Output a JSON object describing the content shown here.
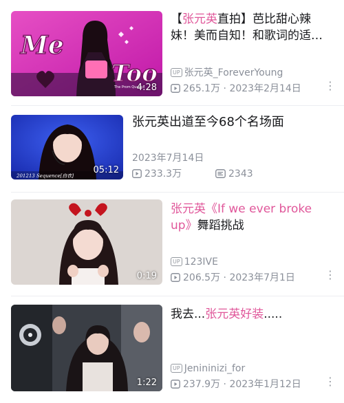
{
  "videos": [
    {
      "title_prefix": "【",
      "title_highlight": "张元英",
      "title_rest": "直拍】芭比甜心辣妹！美而自知！和歌词的适…",
      "thumb_overlay_text_1": "Me",
      "thumb_overlay_text_2": "Too",
      "thumb_overlay_small": "The Prom Queens",
      "duration": "4:28",
      "up_badge": "UP",
      "uploader": "张元英_ForeverYoung",
      "views": "265.1万",
      "separator": "·",
      "date": "2023年2月14日"
    },
    {
      "title": "张元英出道至今68个名场面",
      "thumb_caption": "201213 Sequence[白衣]",
      "duration": "05:12",
      "date": "2023年7月14日",
      "views": "233.3万",
      "danmaku": "2343"
    },
    {
      "title_highlight": "张元英《If we ever broke up》",
      "title_rest": "舞蹈挑战",
      "duration": "0:19",
      "up_badge": "UP",
      "uploader": "123IVE",
      "views": "206.5万",
      "separator": "·",
      "date": "2023年7月1日"
    },
    {
      "title_prefix": "我去...",
      "title_highlight": "张元英好装",
      "title_rest": ".....",
      "duration": "1:22",
      "up_badge": "UP",
      "uploader": "Jenininizi_for",
      "views": "237.9万",
      "separator": "·",
      "date": "2023年1月12日"
    }
  ],
  "colors": {
    "highlight": "#e0579a",
    "meta": "#8a8f99",
    "title": "#18191c"
  }
}
